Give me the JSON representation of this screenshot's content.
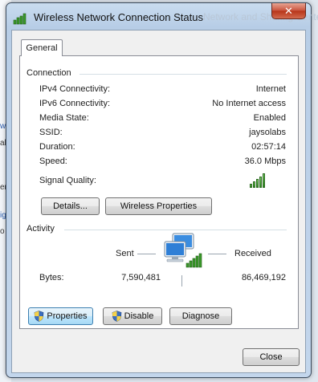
{
  "window": {
    "title": "Wireless Network Connection Status",
    "background_ghost_text": "Network and Sharing Center",
    "close_glyph": "✕"
  },
  "background_app": {
    "fragments": [
      "w",
      "al",
      "er",
      "ig",
      "o"
    ]
  },
  "tabs": [
    {
      "label": "General"
    }
  ],
  "connection": {
    "heading": "Connection",
    "rows": [
      {
        "label": "IPv4 Connectivity:",
        "value": "Internet"
      },
      {
        "label": "IPv6 Connectivity:",
        "value": "No Internet access"
      },
      {
        "label": "Media State:",
        "value": "Enabled"
      },
      {
        "label": "SSID:",
        "value": "jaysolabs"
      },
      {
        "label": "Duration:",
        "value": "02:57:14"
      },
      {
        "label": "Speed:",
        "value": "36.0 Mbps"
      }
    ],
    "signal_quality_label": "Signal Quality:",
    "signal_level": 5,
    "signal_max": 5,
    "details_button": "Details...",
    "wireless_properties_button": "Wireless Properties"
  },
  "activity": {
    "heading": "Activity",
    "sent_label": "Sent",
    "received_label": "Received",
    "bytes_label": "Bytes:",
    "bytes_sent": "7,590,481",
    "bytes_received": "86,469,192"
  },
  "actions": {
    "properties_button": "Properties",
    "disable_button": "Disable",
    "diagnose_button": "Diagnose"
  },
  "footer": {
    "close_button": "Close"
  },
  "colors": {
    "signal_green": "#2f8f20",
    "close_red": "#c8523b",
    "focus_blue": "#3c7fb1"
  },
  "icons": [
    "wireless-signal-icon",
    "network-computers-icon",
    "uac-shield-icon"
  ]
}
